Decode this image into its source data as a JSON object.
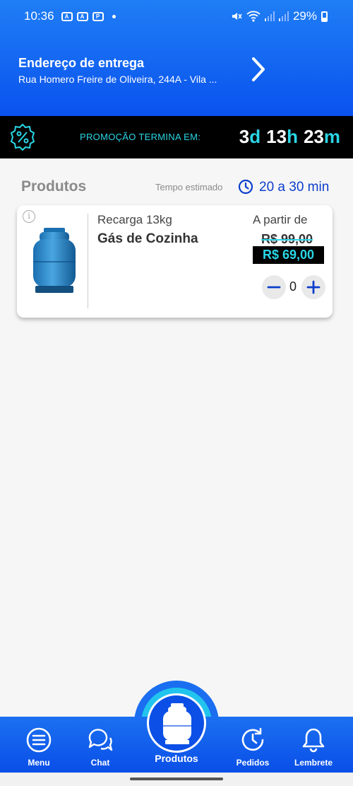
{
  "status_bar": {
    "time": "10:36",
    "battery": "29%",
    "icons": [
      "aa-icon",
      "aa-icon",
      "parking-icon",
      "mute-icon",
      "wifi-icon",
      "signal-icon",
      "signal-icon",
      "battery-icon"
    ]
  },
  "delivery": {
    "title": "Endereço de entrega",
    "address": "Rua Homero Freire de Oliveira, 244A - Vila ..."
  },
  "promo": {
    "label": "PROMOÇÃO TERMINA EM:",
    "days": "3",
    "days_unit": "d",
    "hours": "13",
    "hours_unit": "h",
    "minutes": "23",
    "minutes_unit": "m"
  },
  "products_section": {
    "title": "Produtos",
    "estimate_label": "Tempo estimado",
    "estimate_value": "20 a 30 min"
  },
  "product": {
    "subtitle": "Recarga 13kg",
    "name": "Gás de Cozinha",
    "price_prefix": "A partir de",
    "old_price": "R$ 99,00",
    "new_price": "R$ 69,00",
    "quantity": "0"
  },
  "nav": {
    "items": [
      {
        "label": "Menu",
        "icon": "menu-icon"
      },
      {
        "label": "Chat",
        "icon": "chat-icon"
      },
      {
        "label": "Produtos",
        "icon": "gas-cylinder-icon"
      },
      {
        "label": "Pedidos",
        "icon": "history-icon"
      },
      {
        "label": "Lembrete",
        "icon": "bell-icon"
      }
    ]
  },
  "colors": {
    "primary": "#0a52ee",
    "accent": "#2ad6e6",
    "promo_bg": "#000000",
    "text_blue": "#0c3ecc"
  }
}
